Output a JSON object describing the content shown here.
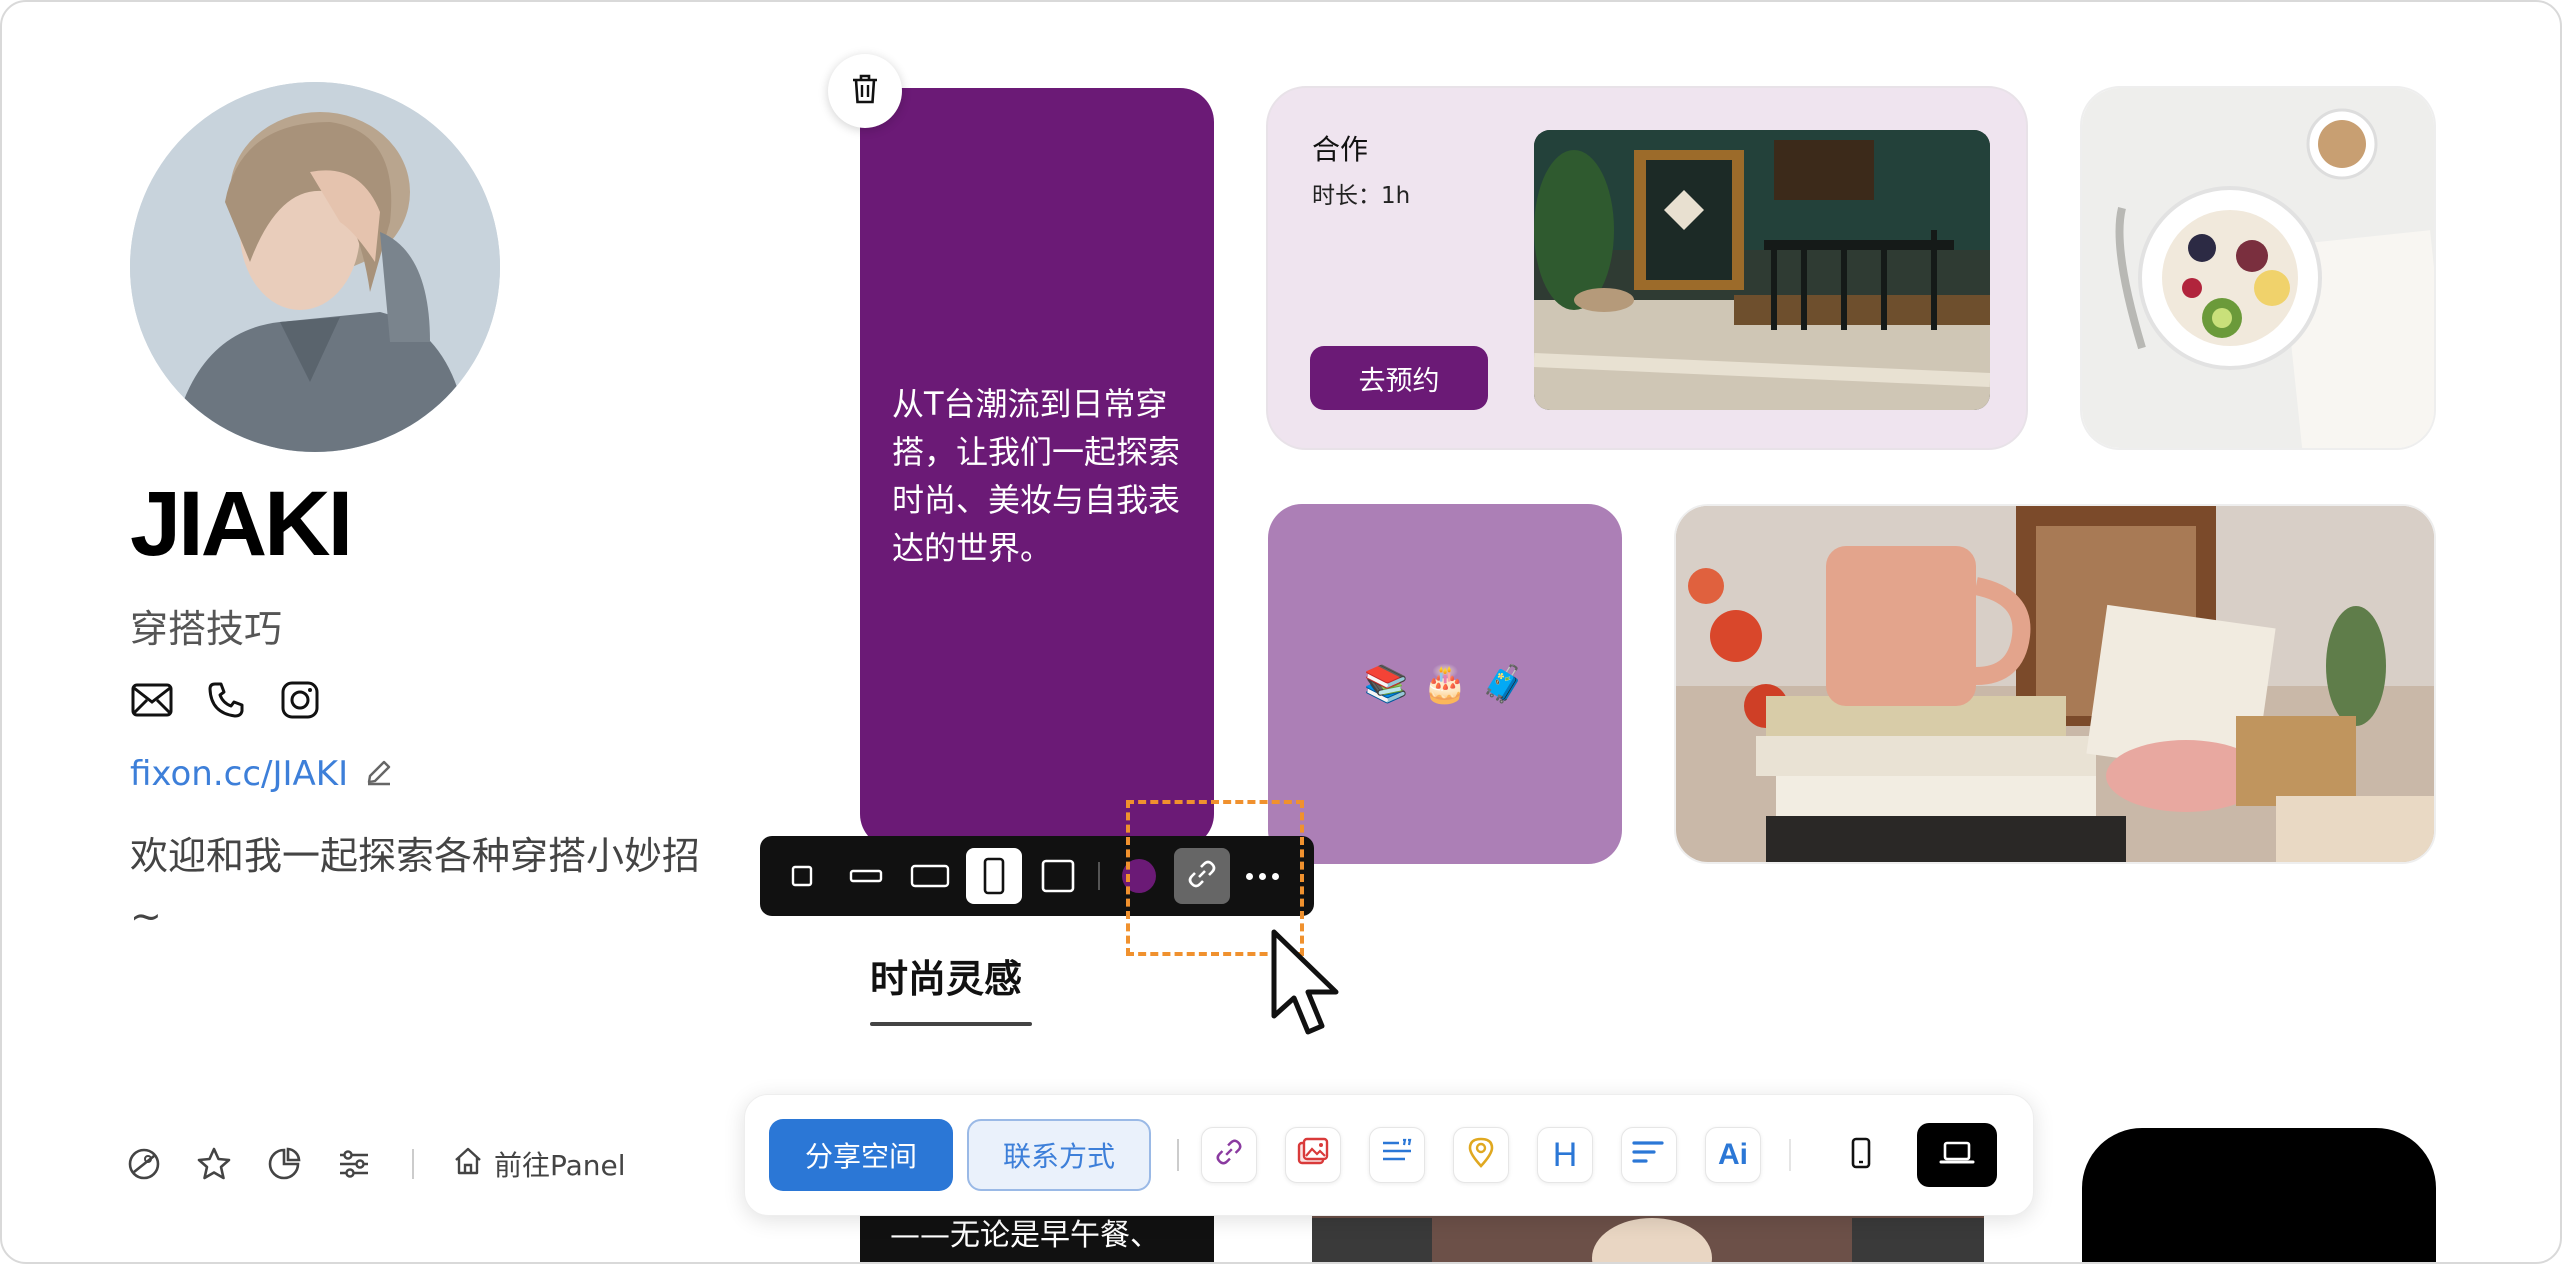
{
  "profile": {
    "name": "JIAKI",
    "tagline": "穿搭技巧",
    "url": "fixon.cc/JIAKI",
    "bio": "欢迎和我一起探索各种穿搭小妙招~"
  },
  "bottom_left": {
    "panel_link": "前往Panel"
  },
  "cards": {
    "purple_text": "从T台潮流到日常穿搭，让我们一起探索时尚、美妆与自我表达的世界。",
    "coop_title": "合作",
    "coop_duration": "时长：1h",
    "coop_button": "去预约",
    "emoji": [
      "📚",
      "🎂",
      "🧳"
    ]
  },
  "section": {
    "title": "时尚灵感"
  },
  "peek": {
    "text": "——无论是早午餐、"
  },
  "toolbar": {
    "share_label": "分享空间",
    "contact_label": "联系方式",
    "h_label": "H",
    "ai_label": "Ai"
  },
  "colors": {
    "brand_purple": "#6b1a76",
    "light_purple": "#ac7fb6",
    "link_blue": "#3d7fd9",
    "primary_blue": "#2b77d6",
    "highlight_orange": "#f0912e"
  }
}
